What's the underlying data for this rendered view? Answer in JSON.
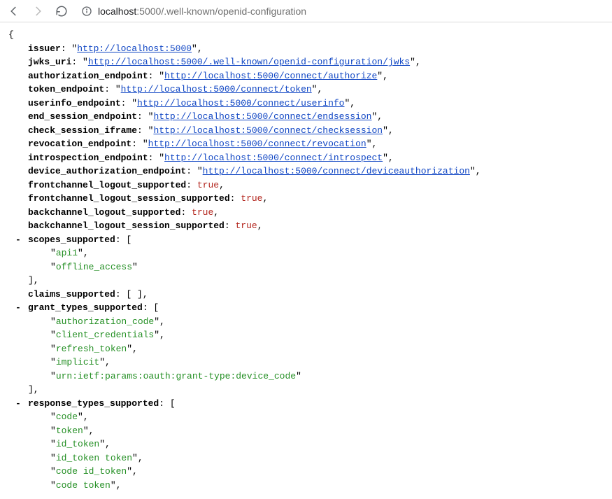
{
  "toolbar": {
    "url_host": "localhost",
    "url_port": ":5000",
    "url_path": "/.well-known/openid-configuration"
  },
  "json": {
    "issuer": {
      "key": "issuer",
      "val": "http://localhost:5000"
    },
    "jwks_uri": {
      "key": "jwks_uri",
      "val": "http://localhost:5000/.well-known/openid-configuration/jwks"
    },
    "authorization_endpoint": {
      "key": "authorization_endpoint",
      "val": "http://localhost:5000/connect/authorize"
    },
    "token_endpoint": {
      "key": "token_endpoint",
      "val": "http://localhost:5000/connect/token"
    },
    "userinfo_endpoint": {
      "key": "userinfo_endpoint",
      "val": "http://localhost:5000/connect/userinfo"
    },
    "end_session_endpoint": {
      "key": "end_session_endpoint",
      "val": "http://localhost:5000/connect/endsession"
    },
    "check_session_iframe": {
      "key": "check_session_iframe",
      "val": "http://localhost:5000/connect/checksession"
    },
    "revocation_endpoint": {
      "key": "revocation_endpoint",
      "val": "http://localhost:5000/connect/revocation"
    },
    "introspection_endpoint": {
      "key": "introspection_endpoint",
      "val": "http://localhost:5000/connect/introspect"
    },
    "device_authorization_endpoint": {
      "key": "device_authorization_endpoint",
      "val": "http://localhost:5000/connect/deviceauthorization"
    },
    "frontchannel_logout_supported": {
      "key": "frontchannel_logout_supported",
      "val": "true"
    },
    "frontchannel_logout_session_supported": {
      "key": "frontchannel_logout_session_supported",
      "val": "true"
    },
    "backchannel_logout_supported": {
      "key": "backchannel_logout_supported",
      "val": "true"
    },
    "backchannel_logout_session_supported": {
      "key": "backchannel_logout_session_supported",
      "val": "true"
    },
    "scopes_supported": {
      "key": "scopes_supported",
      "items": [
        "api1",
        "offline_access"
      ]
    },
    "claims_supported": {
      "key": "claims_supported"
    },
    "grant_types_supported": {
      "key": "grant_types_supported",
      "items": [
        "authorization_code",
        "client_credentials",
        "refresh_token",
        "implicit",
        "urn:ietf:params:oauth:grant-type:device_code"
      ]
    },
    "response_types_supported": {
      "key": "response_types_supported",
      "items": [
        "code",
        "token",
        "id_token",
        "id_token token",
        "code id_token",
        "code token"
      ]
    }
  }
}
